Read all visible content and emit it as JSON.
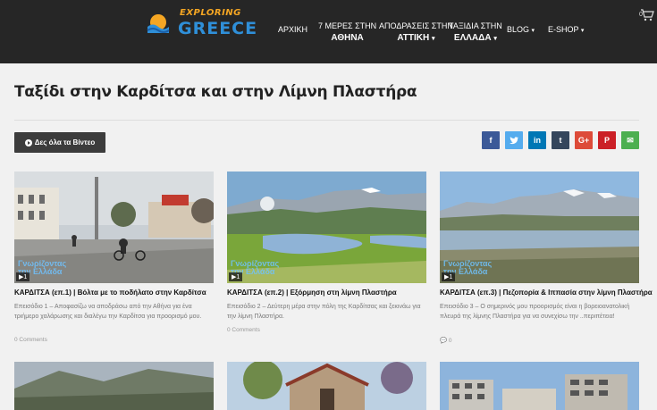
{
  "header": {
    "logo_small": "EXPLORING",
    "logo_main": "GREECE",
    "nav": [
      {
        "l1": "ΑΡΧΙΚΗ",
        "l2": ""
      },
      {
        "l1": "7 ΜΕΡΕΣ ΣΤΗΝ",
        "l2": "ΑΘΗΝΑ"
      },
      {
        "l1": "ΑΠΟΔΡΑΣΕΙΣ ΣΤΗΝ",
        "l2": "ΑΤΤΙΚΗ"
      },
      {
        "l1": "ΤΑΞΙΔΙΑ ΣΤΗΝ",
        "l2": "ΕΛΛΑΔΑ"
      },
      {
        "l1": "BLOG",
        "l2": ""
      },
      {
        "l1": "E-SHOP",
        "l2": ""
      }
    ],
    "caret": "▾",
    "cart_count": "0"
  },
  "page": {
    "title": "Ταξίδι στην Καρδίτσα και στην Λίμνη Πλαστήρα",
    "video_button": "Δες όλα τα Βίντεο"
  },
  "share": [
    {
      "name": "facebook",
      "glyph": "f",
      "color": "#3b5998"
    },
    {
      "name": "twitter",
      "glyph": "t",
      "color": "#55acee"
    },
    {
      "name": "linkedin",
      "glyph": "in",
      "color": "#0077b5"
    },
    {
      "name": "tumblr",
      "glyph": "t",
      "color": "#35465c"
    },
    {
      "name": "googleplus",
      "glyph": "G+",
      "color": "#dd4b39"
    },
    {
      "name": "pinterest",
      "glyph": "P",
      "color": "#cb2027"
    },
    {
      "name": "email",
      "glyph": "✉",
      "color": "#4caf50"
    }
  ],
  "cards": [
    {
      "badge": "▶1",
      "watermark_1": "Γνωρίζοντας",
      "watermark_2": "την Ελλάδα",
      "title": "ΚΑΡΔΙΤΣΑ (επ.1) | Βόλτα με το ποδήλατο στην Καρδίτσα",
      "desc": "Επεισόδιο 1 – Αποφασίζω να αποδράσω από την Αθήνα για ένα τριήμερο χαλάρωσης και διαλέγω την Καρδίτσα για προορισμό μου.",
      "meta": "0 Comments"
    },
    {
      "badge": "▶1",
      "watermark_1": "Γνωρίζοντας",
      "watermark_2": "την Ελλάδα",
      "title": "ΚΑΡΔΙΤΣΑ (επ.2) | Εξόρμηση στη λίμνη Πλαστήρα",
      "desc": "Επεισόδιο 2 – Δεύτερη μέρα στην πόλη της Καρδίτσας και ξεκινάω για την λίμνη Πλαστήρα.",
      "meta": "0 Comments"
    },
    {
      "badge": "▶1",
      "watermark_1": "Γνωρίζοντας",
      "watermark_2": "την Ελλάδα",
      "title": "ΚΑΡΔΙΤΣΑ (επ.3) | Πεζοπορία & Ιππασία στην λίμνη Πλαστήρα",
      "desc": "Επεισόδιο 3 – Ο σημερινός μου προορισμός είναι η βορειοανατολική πλευρά της λίμνης Πλαστήρα για να συνεχίσω την ..περιπέτεια!",
      "meta": "0"
    }
  ]
}
